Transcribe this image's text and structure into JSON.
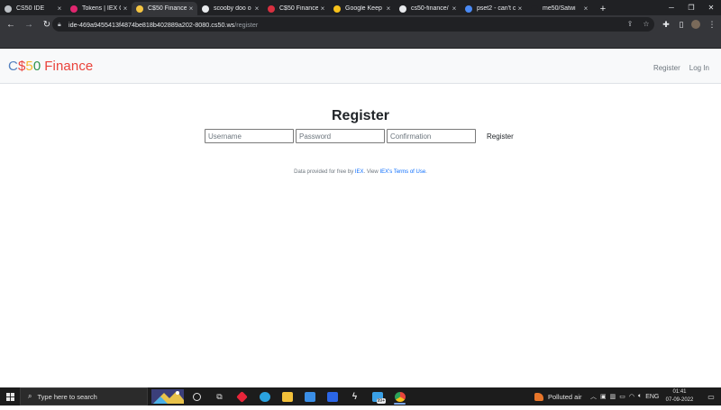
{
  "browser": {
    "tabs": [
      {
        "title": "CS50 IDE",
        "favicon_color": "#bdc1c6",
        "active": false
      },
      {
        "title": "Tokens | IEX C",
        "favicon_color": "#e0266f",
        "active": false
      },
      {
        "title": "C$50 Finance",
        "favicon_color": "#f5c542",
        "active": true
      },
      {
        "title": "scooby doo o",
        "favicon_color": "#e8eaed",
        "active": false
      },
      {
        "title": "C$50 Finance",
        "favicon_color": "#d93040",
        "active": false
      },
      {
        "title": "Google Keep",
        "favicon_color": "#f7c21b",
        "active": false
      },
      {
        "title": "cs50-finance/",
        "favicon_color": "#e8eaed",
        "active": false
      },
      {
        "title": "pset2 - can't c",
        "favicon_color": "#4a8af4",
        "active": false
      },
      {
        "title": "me50/Satwi",
        "favicon_color": "#202124",
        "active": false
      }
    ],
    "close_glyph": "×",
    "newtab_glyph": "+",
    "url_host": "ide-469a9455413f4874be818b402889a202-8080.cs50.ws",
    "url_path": "/register",
    "icons": {
      "back": "back-arrow-icon",
      "forward": "forward-arrow-icon",
      "reload": "reload-icon",
      "lock": "lock-icon",
      "share": "share-icon",
      "star": "star-icon",
      "extensions": "puzzle-icon",
      "sidepanel": "side-panel-icon",
      "profile": "profile-icon",
      "menu": "kebab-menu-icon"
    }
  },
  "app": {
    "brand": {
      "p1": "C",
      "p2": "$",
      "p3": "5",
      "p4": "0",
      "p5": "Finance"
    },
    "nav": {
      "register": "Register",
      "login": "Log In"
    },
    "form": {
      "title": "Register",
      "username_placeholder": "Username",
      "password_placeholder": "Password",
      "confirmation_placeholder": "Confirmation",
      "submit_label": "Register"
    },
    "footer": {
      "prefix": "Data provided for free by ",
      "iex_link": "IEX",
      "middle": ". View ",
      "terms_link": "IEX's Terms of Use",
      "suffix": "."
    }
  },
  "taskbar": {
    "search_placeholder": "Type here to search",
    "badge": "99+",
    "weather": "Polluted air",
    "lang": "ENG",
    "time": "01:41",
    "date": "07-09-2022"
  }
}
